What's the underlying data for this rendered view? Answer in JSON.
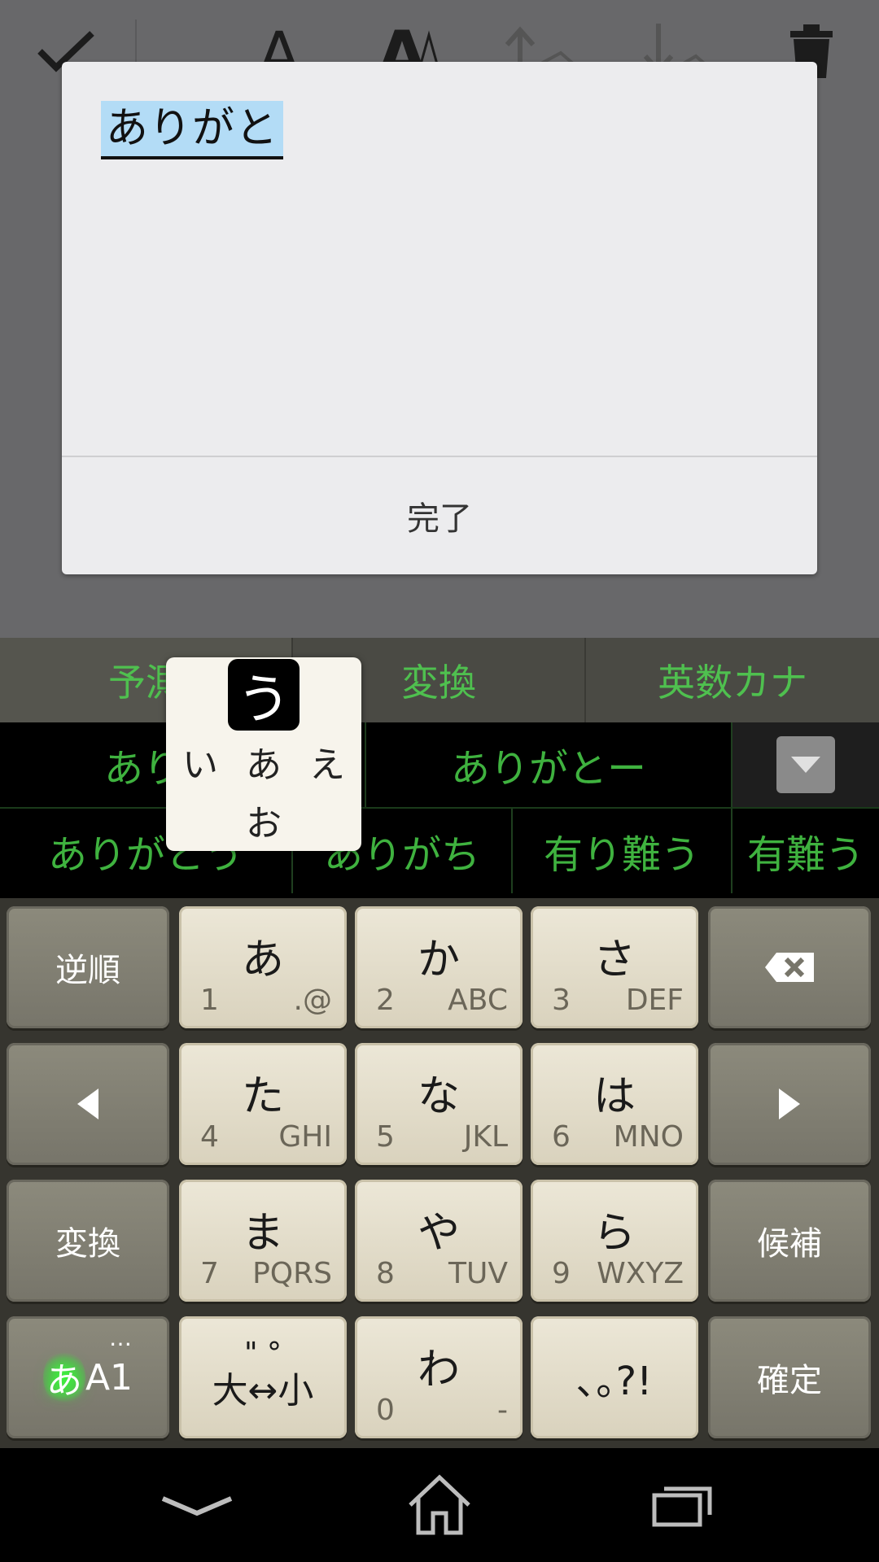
{
  "dialog": {
    "text": "ありがと",
    "done_label": "完了"
  },
  "ime": {
    "mode_tabs": [
      "予測",
      "変換",
      "英数カナ"
    ],
    "candidates_row1": [
      "ありがと",
      "ありがとー"
    ],
    "candidates_row2": [
      "ありがとう",
      "ありがち",
      "有り難う",
      "有難う"
    ],
    "flick": {
      "center": "う",
      "left": "い",
      "up_center": "あ",
      "right": "え",
      "down": "お"
    }
  },
  "keyboard": {
    "reverse": "逆順",
    "convert": "変換",
    "candidates": "候補",
    "confirm": "確定",
    "keys": [
      {
        "main": "あ",
        "num": "1",
        "alt": ".@"
      },
      {
        "main": "か",
        "num": "2",
        "alt": "ABC"
      },
      {
        "main": "さ",
        "num": "3",
        "alt": "DEF"
      },
      {
        "main": "た",
        "num": "4",
        "alt": "GHI"
      },
      {
        "main": "な",
        "num": "5",
        "alt": "JKL"
      },
      {
        "main": "は",
        "num": "6",
        "alt": "MNO"
      },
      {
        "main": "ま",
        "num": "7",
        "alt": "PQRS"
      },
      {
        "main": "や",
        "num": "8",
        "alt": "TUV"
      },
      {
        "main": "ら",
        "num": "9",
        "alt": "WXYZ"
      },
      {
        "main": "わ",
        "num": "0",
        "alt": "-"
      }
    ],
    "dakuten_top": "\"  °",
    "dakuten_bottom": "大↔小",
    "punct": "､｡?!",
    "mode_hira": "あ",
    "mode_rest": "A1",
    "mode_dots": "…"
  },
  "icons": {
    "check": "check-icon",
    "text_small": "text-smaller-icon",
    "text_large": "text-larger-icon",
    "move_up": "move-up-icon",
    "move_down": "move-down-icon",
    "trash": "trash-icon",
    "backspace": "backspace-icon",
    "cursor_left": "cursor-left-icon",
    "cursor_right": "cursor-right-icon",
    "expand": "expand-down-icon",
    "nav_back": "nav-back-icon",
    "nav_home": "nav-home-icon",
    "nav_recents": "nav-recents-icon"
  },
  "colors": {
    "candidate_green": "#3fb23f",
    "highlight": "#b3dcf6",
    "mode_glow": "#3fdb3f"
  }
}
